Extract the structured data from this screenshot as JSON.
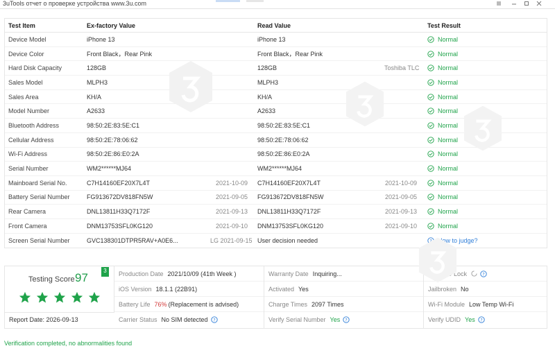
{
  "window": {
    "title": "3uTools отчет о проверке устройства www.3u.com",
    "accent": "#1fa34a",
    "link_color": "#2f7ed8"
  },
  "table": {
    "headers": [
      "Test Item",
      "Ex-factory Value",
      "Read Value",
      "Test Result"
    ],
    "rows": [
      {
        "item": "Device Model",
        "factory": "iPhone 13",
        "factory_date": "",
        "read": "iPhone 13",
        "read_extra": "",
        "result": "Normal"
      },
      {
        "item": "Device Color",
        "factory": "Front Black，Rear Pink",
        "factory_date": "",
        "read": "Front Black，Rear Pink",
        "read_extra": "",
        "result": "Normal"
      },
      {
        "item": "Hard Disk Capacity",
        "factory": "128GB",
        "factory_date": "",
        "read": "128GB",
        "read_extra": "Toshiba TLC",
        "result": "Normal"
      },
      {
        "item": "Sales Model",
        "factory": "MLPH3",
        "factory_date": "",
        "read": "MLPH3",
        "read_extra": "",
        "result": "Normal"
      },
      {
        "item": "Sales Area",
        "factory": "KH/A",
        "factory_date": "",
        "read": "KH/A",
        "read_extra": "",
        "result": "Normal"
      },
      {
        "item": "Model Number",
        "factory": "A2633",
        "factory_date": "",
        "read": "A2633",
        "read_extra": "",
        "result": "Normal"
      },
      {
        "item": "Bluetooth Address",
        "factory": "98:50:2E:83:5E:C1",
        "factory_date": "",
        "read": "98:50:2E:83:5E:C1",
        "read_extra": "",
        "result": "Normal"
      },
      {
        "item": "Cellular Address",
        "factory": "98:50:2E:78:06:62",
        "factory_date": "",
        "read": "98:50:2E:78:06:62",
        "read_extra": "",
        "result": "Normal"
      },
      {
        "item": "Wi-Fi Address",
        "factory": "98:50:2E:86:E0:2A",
        "factory_date": "",
        "read": "98:50:2E:86:E0:2A",
        "read_extra": "",
        "result": "Normal"
      },
      {
        "item": "Serial Number",
        "factory": "WM2******MJ64",
        "factory_date": "",
        "read": "WM2******MJ64",
        "read_extra": "",
        "result": "Normal"
      },
      {
        "item": "Mainboard Serial No.",
        "factory": "C7H14160EF20X7L4T",
        "factory_date": "2021-10-09",
        "read": "C7H14160EF20X7L4T",
        "read_extra": "2021-10-09",
        "result": "Normal"
      },
      {
        "item": "Battery Serial Number",
        "factory": "FG913672DV818FN5W",
        "factory_date": "2021-09-05",
        "read": "FG913672DV818FN5W",
        "read_extra": "2021-09-05",
        "result": "Normal"
      },
      {
        "item": "Rear Camera",
        "factory": "DNL13811H33Q7172F",
        "factory_date": "2021-09-13",
        "read": "DNL13811H33Q7172F",
        "read_extra": "2021-09-13",
        "result": "Normal"
      },
      {
        "item": "Front Camera",
        "factory": "DNM13753SFL0KG120",
        "factory_date": "2021-09-10",
        "read": "DNM13753SFL0KG120",
        "read_extra": "2021-09-10",
        "result": "Normal"
      },
      {
        "item": "Screen Serial Number",
        "factory": "GVC138301DTPR5RAV+A0E6...",
        "factory_date": "LG 2021-09-15",
        "read": "User decision needed",
        "read_extra": "",
        "result": "How to judge?"
      }
    ]
  },
  "score": {
    "label": "Testing Score",
    "value": "97",
    "badge": "3",
    "stars": 5,
    "report_date_label": "Report Date:",
    "report_date": "2026-09-13"
  },
  "info": {
    "col1": [
      {
        "label": "Production Date",
        "value": "2021/10/09 (41th Week )"
      },
      {
        "label": "iOS Version",
        "value": "18.1.1 (22B91)"
      },
      {
        "label": "Battery Life",
        "value_red": "76%",
        "value": "(Replacement is advised)"
      },
      {
        "label": "Carrier Status",
        "value": "No SIM detected"
      }
    ],
    "col2": [
      {
        "label": "Warranty Date",
        "value": "Inquiring..."
      },
      {
        "label": "Activated",
        "value": "Yes"
      },
      {
        "label": "Charge Times",
        "value": "2097 Times"
      },
      {
        "label": "Verify Serial Number",
        "value": "Yes"
      }
    ],
    "col3": [
      {
        "label": "Apple ID Lock",
        "value": ""
      },
      {
        "label": "Jailbroken",
        "value": "No"
      },
      {
        "label": "Wi-Fi Module",
        "value": "Low Temp Wi-Fi"
      },
      {
        "label": "Verify UDID",
        "value": "Yes"
      }
    ]
  },
  "footer": {
    "status": "Verification completed, no abnormalities found"
  }
}
